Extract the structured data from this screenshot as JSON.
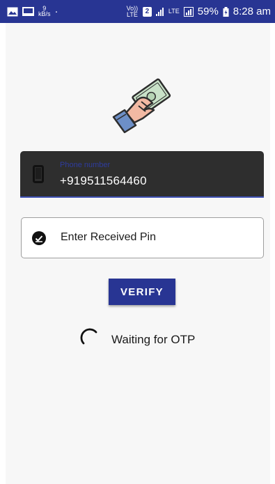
{
  "status_bar": {
    "speed_value": "9",
    "speed_unit": "kB/s",
    "dot": "·",
    "volte_label": "Vo)) LTE",
    "sim_number": "2",
    "lte_label": "LTE",
    "battery_percent": "59%",
    "time": "8:28 am"
  },
  "phone_field": {
    "label": "Phone number",
    "value": "+919511564460",
    "icon": "phone-icon"
  },
  "pin_field": {
    "placeholder": "Enter Received Pin",
    "icon": "check-circle-icon"
  },
  "verify_button": {
    "label": "VERIFY"
  },
  "status": {
    "waiting_text": "Waiting for OTP"
  },
  "colors": {
    "status_bar": "#283593",
    "accent": "#3f51b5",
    "field_dark": "#2e2e2e"
  }
}
